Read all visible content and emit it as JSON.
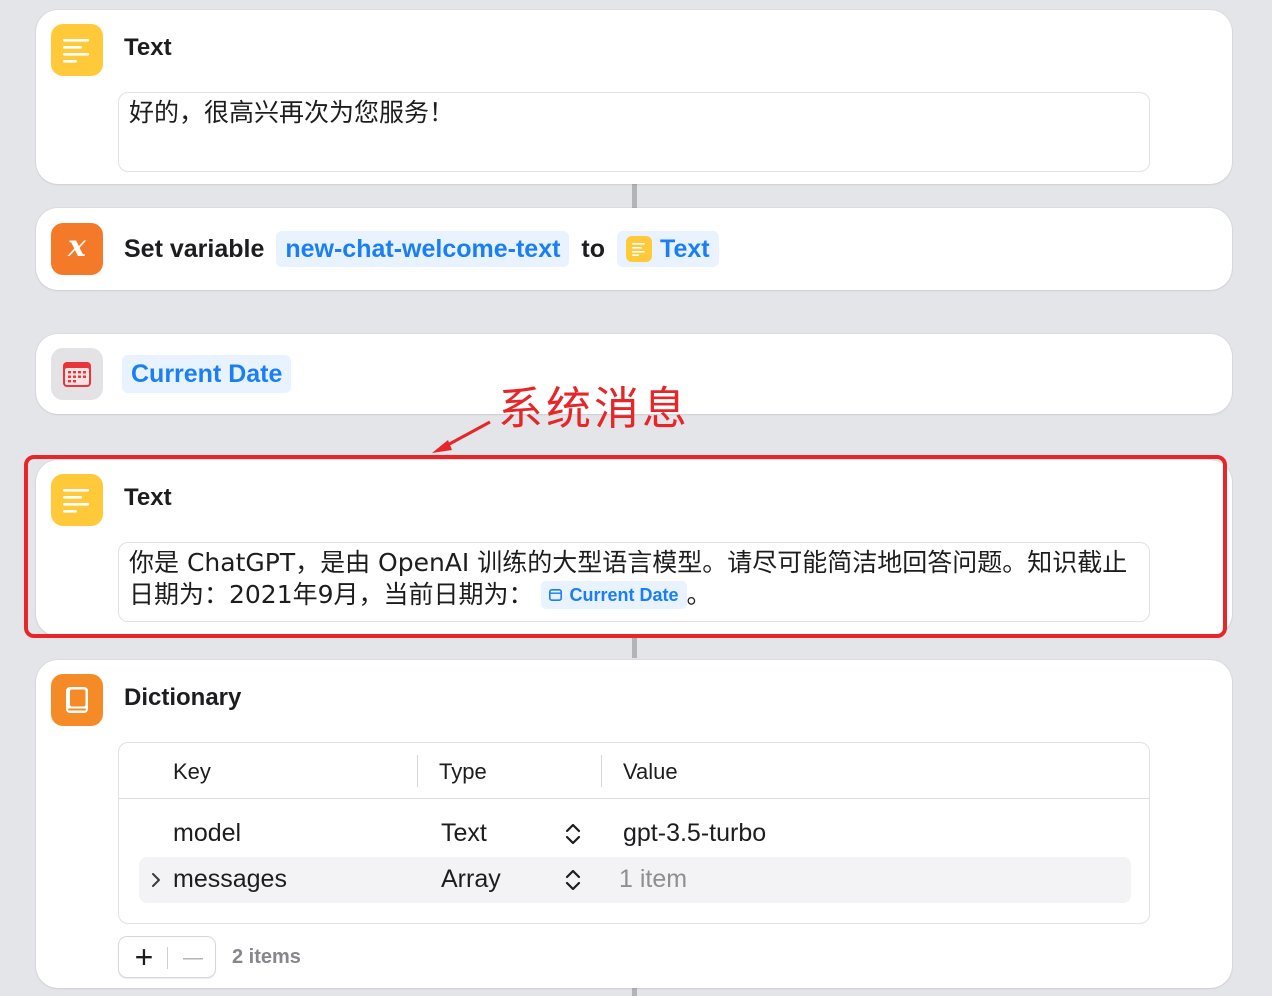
{
  "blocks": {
    "text1": {
      "title": "Text",
      "content": "好的，很高兴再次为您服务！"
    },
    "set_variable": {
      "title": "Set variable",
      "variable_name": "new-chat-welcome-text",
      "to_label": "to",
      "value_label": "Text"
    },
    "current_date": {
      "label": "Current Date"
    },
    "text2": {
      "title": "Text",
      "content_part1": "你是 ChatGPT，是由 OpenAI 训练的大型语言模型。请尽可能简洁地回答问题。知识截止日期为：2021年9月，当前日期为：",
      "date_token": "Current Date",
      "content_end": "。"
    },
    "dictionary": {
      "title": "Dictionary",
      "columns": [
        "Key",
        "Type",
        "Value"
      ],
      "rows": [
        {
          "key": "model",
          "type": "Text",
          "value": "gpt-3.5-turbo"
        },
        {
          "key": "messages",
          "type": "Array",
          "value": "1 item"
        }
      ],
      "add_label": "+",
      "remove_label": "—",
      "count_text": "2 items"
    }
  },
  "annotation": {
    "text": "系统消息",
    "color": "#e8262a"
  },
  "colors": {
    "accent_blue": "#1a7ff5",
    "text_icon_yellow": "#ffc93a",
    "variable_icon_orange": "#f47a2a",
    "dictionary_icon_orange": "#f58b26"
  },
  "icons": {
    "text": "text-lines-icon",
    "variable": "variable-x-icon",
    "calendar": "calendar-icon",
    "dictionary": "book-icon"
  }
}
